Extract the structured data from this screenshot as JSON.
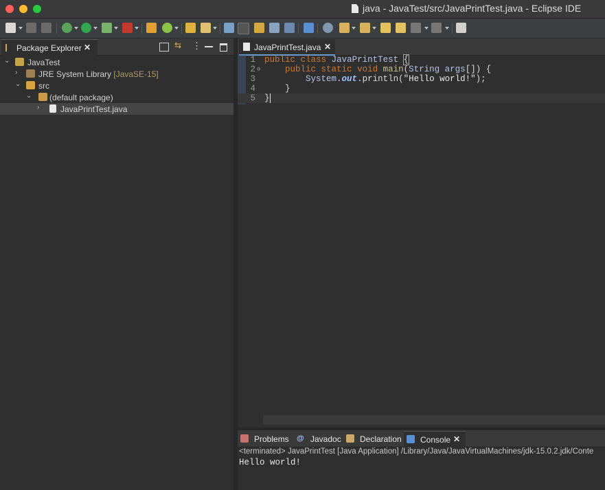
{
  "window": {
    "title": "java - JavaTest/src/JavaPrintTest.java - Eclipse IDE"
  },
  "package_explorer": {
    "tab_label": "Package Explorer",
    "tree": [
      {
        "label": "JavaTest",
        "expanded": true,
        "level": 0
      },
      {
        "label": "JRE System Library",
        "suffix": "[JavaSE-15]",
        "expanded": false,
        "level": 1
      },
      {
        "label": "src",
        "expanded": true,
        "level": 1
      },
      {
        "label": "(default package)",
        "expanded": true,
        "level": 2
      },
      {
        "label": "JavaPrintTest.java",
        "expanded": false,
        "level": 3,
        "selected": true
      }
    ]
  },
  "editor": {
    "tab_label": "JavaPrintTest.java",
    "lines": [
      {
        "num": "1",
        "text": "public class JavaPrintTest {"
      },
      {
        "num": "2",
        "text": "    public static void main(String args[]) {"
      },
      {
        "num": "3",
        "text": "        System.out.println(\"Hello world!\");"
      },
      {
        "num": "4",
        "text": "    }"
      },
      {
        "num": "5",
        "text": "}"
      }
    ]
  },
  "bottom_panel": {
    "tabs": [
      {
        "label": "Problems"
      },
      {
        "label": "Javadoc"
      },
      {
        "label": "Declaration"
      },
      {
        "label": "Console",
        "active": true
      }
    ],
    "terminated": "<terminated> JavaPrintTest [Java Application] /Library/Java/JavaVirtualMachines/jdk-15.0.2.jdk/Conte",
    "output": "Hello world!"
  },
  "colors": {
    "keyword": "#cc7832",
    "selection_line": "#383838",
    "accent": "#6a9ad0"
  }
}
